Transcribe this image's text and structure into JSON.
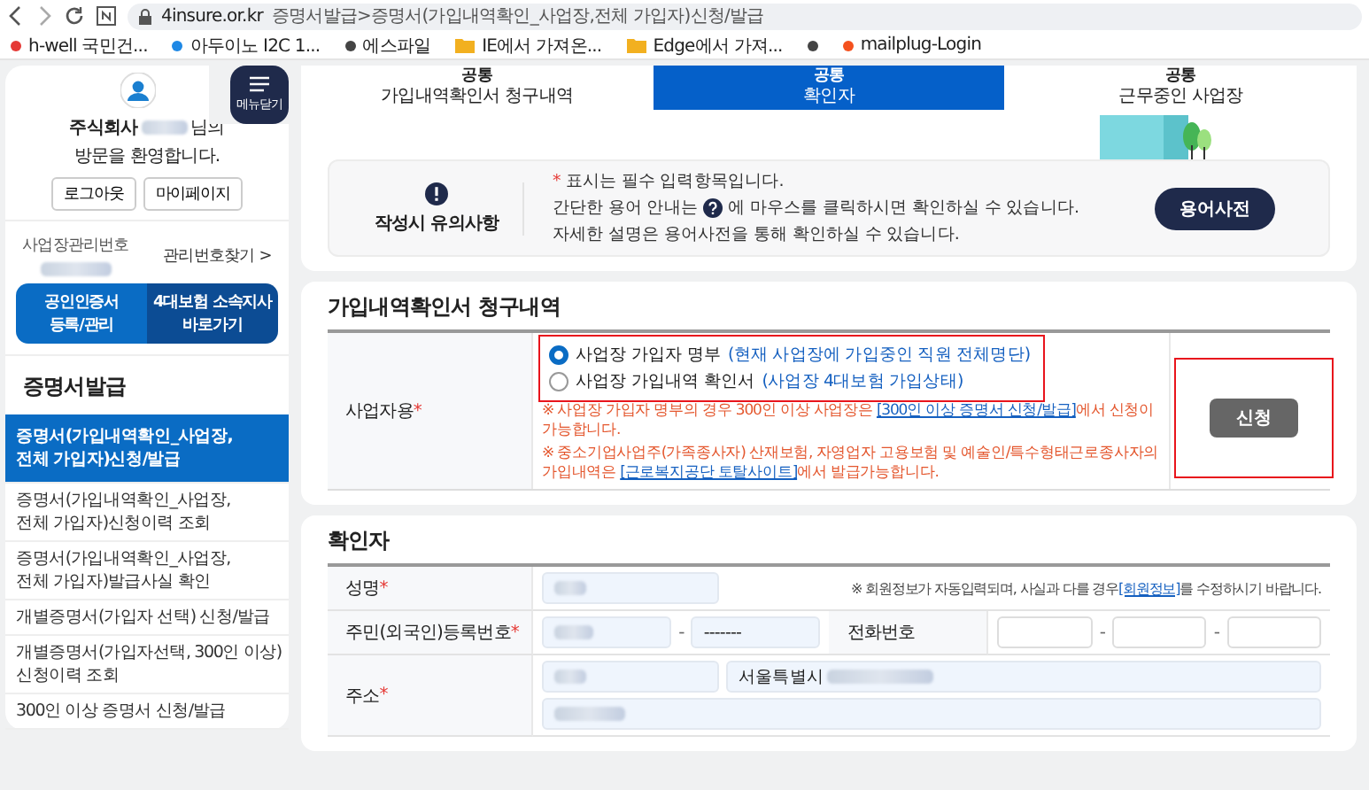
{
  "browser": {
    "host": "4insure.or.kr",
    "path": "증명서발급>증명서(가입내역확인_사업장,전체 가입자)신청/발급",
    "bookmarks": [
      {
        "kind": "dot",
        "color": "#e53935",
        "label": "h-well 국민건..."
      },
      {
        "kind": "dot",
        "color": "#1e88e5",
        "label": "아두이노 I2C 1..."
      },
      {
        "kind": "dot",
        "color": "#444444",
        "label": "에스파일"
      },
      {
        "kind": "folder",
        "label": "IE에서 가져온..."
      },
      {
        "kind": "folder",
        "label": "Edge에서 가져..."
      },
      {
        "kind": "dot",
        "color": "#444444"
      },
      {
        "kind": "dot",
        "color": "#f4511e",
        "label": "mailplug-Login"
      }
    ]
  },
  "sidebar": {
    "menu_button": "메뉴닫기",
    "greeting_prefix": "주식회사",
    "greeting_suffix": "님의",
    "greeting_line2": "방문을 환영합니다.",
    "buttons": [
      "로그아웃",
      "마이페이지"
    ],
    "manage_label": "사업장관리번호",
    "manage_link": "관리번호찾기 >",
    "quick_links": [
      {
        "lines": [
          "공인인증서",
          "등록/관리"
        ]
      },
      {
        "lines": [
          "4대보험 소속지사",
          "바로가기"
        ]
      }
    ],
    "section_title": "증명서발급",
    "items": [
      {
        "lines": [
          "증명서(가입내역확인_사업장,",
          "전체 가입자)신청/발급"
        ],
        "selected": true
      },
      {
        "lines": [
          "증명서(가입내역확인_사업장,",
          "전체 가입자)신청이력 조회"
        ],
        "selected": false
      },
      {
        "lines": [
          "증명서(가입내역확인_사업장,",
          "전체 가입자)발급사실 확인"
        ],
        "selected": false
      },
      {
        "lines": [
          "개별증명서(가입자 선택) 신청/발급"
        ],
        "selected": false
      },
      {
        "lines": [
          "개별증명서(가입자선택, 300인 이상)",
          "신청이력 조회"
        ],
        "selected": false
      },
      {
        "lines": [
          "300인 이상 증명서 신청/발급"
        ],
        "selected": false
      }
    ]
  },
  "tabs": [
    {
      "top": "공통",
      "label": "가입내역확인서 청구내역",
      "selected": false
    },
    {
      "top": "공통",
      "label": "확인자",
      "selected": true
    },
    {
      "top": "공통",
      "label": "근무중인 사업장",
      "selected": false
    }
  ],
  "notice": {
    "title": "작성시 유의사항",
    "star": "*",
    "line1": "표시는 필수 입력항목입니다.",
    "line2_before": "간단한 용어 안내는",
    "line2_after": "에 마우스를 클릭하시면 확인하실 수 있습니다.",
    "line3": "자세한 설명은 용어사전을 통해 확인하실 수 있습니다.",
    "button": "용어사전"
  },
  "request": {
    "title": "가입내역확인서 청구내역",
    "label": "사업자용",
    "required": "*",
    "options_highlighted": true,
    "options": [
      {
        "label": "사업장 가입자 명부",
        "note": "(현재 사업장에 가입중인 직원 전체명단)",
        "selected": true
      },
      {
        "label": "사업장 가입내역 확인서",
        "note": "(사업장 4대보험 가입상태)",
        "selected": false
      }
    ],
    "notes": [
      {
        "before": "※ 사업장 가입자 명부의 경우 300인 이상 사업장은 ",
        "link": "[300인 이상 증명서 신청/발급]",
        "after": "에서 신청이 가능합니다."
      },
      {
        "before": "※ 중소기업사업주(가족종사자) 산재보험, 자영업자 고용보험 및 예술인/특수형태근로종사자의 가입내역은 ",
        "link": "[근로복지공단 토탈사이트]",
        "after": "에서 발급가능합니다."
      }
    ],
    "button": "신청",
    "button_highlighted": true
  },
  "confirmer": {
    "title": "확인자",
    "name": {
      "label": "성명",
      "required": "*",
      "redacted": true,
      "note_before": "※ 회원정보가 자동입력되며, 사실과 다를 경우",
      "note_link": "[회원정보]",
      "note_after": "를 수정하시기 바랍니다."
    },
    "id": {
      "label": "주민(외국인)등록번호",
      "required": "*",
      "first_redacted": true,
      "separator": "-",
      "second": "-------"
    },
    "phone": {
      "label": "전화번호",
      "separator": "-"
    },
    "address": {
      "label": "주소",
      "required": "*",
      "postal_redacted": true,
      "city": "서울특별시",
      "city_redacted": true,
      "detail_redacted": true
    }
  }
}
